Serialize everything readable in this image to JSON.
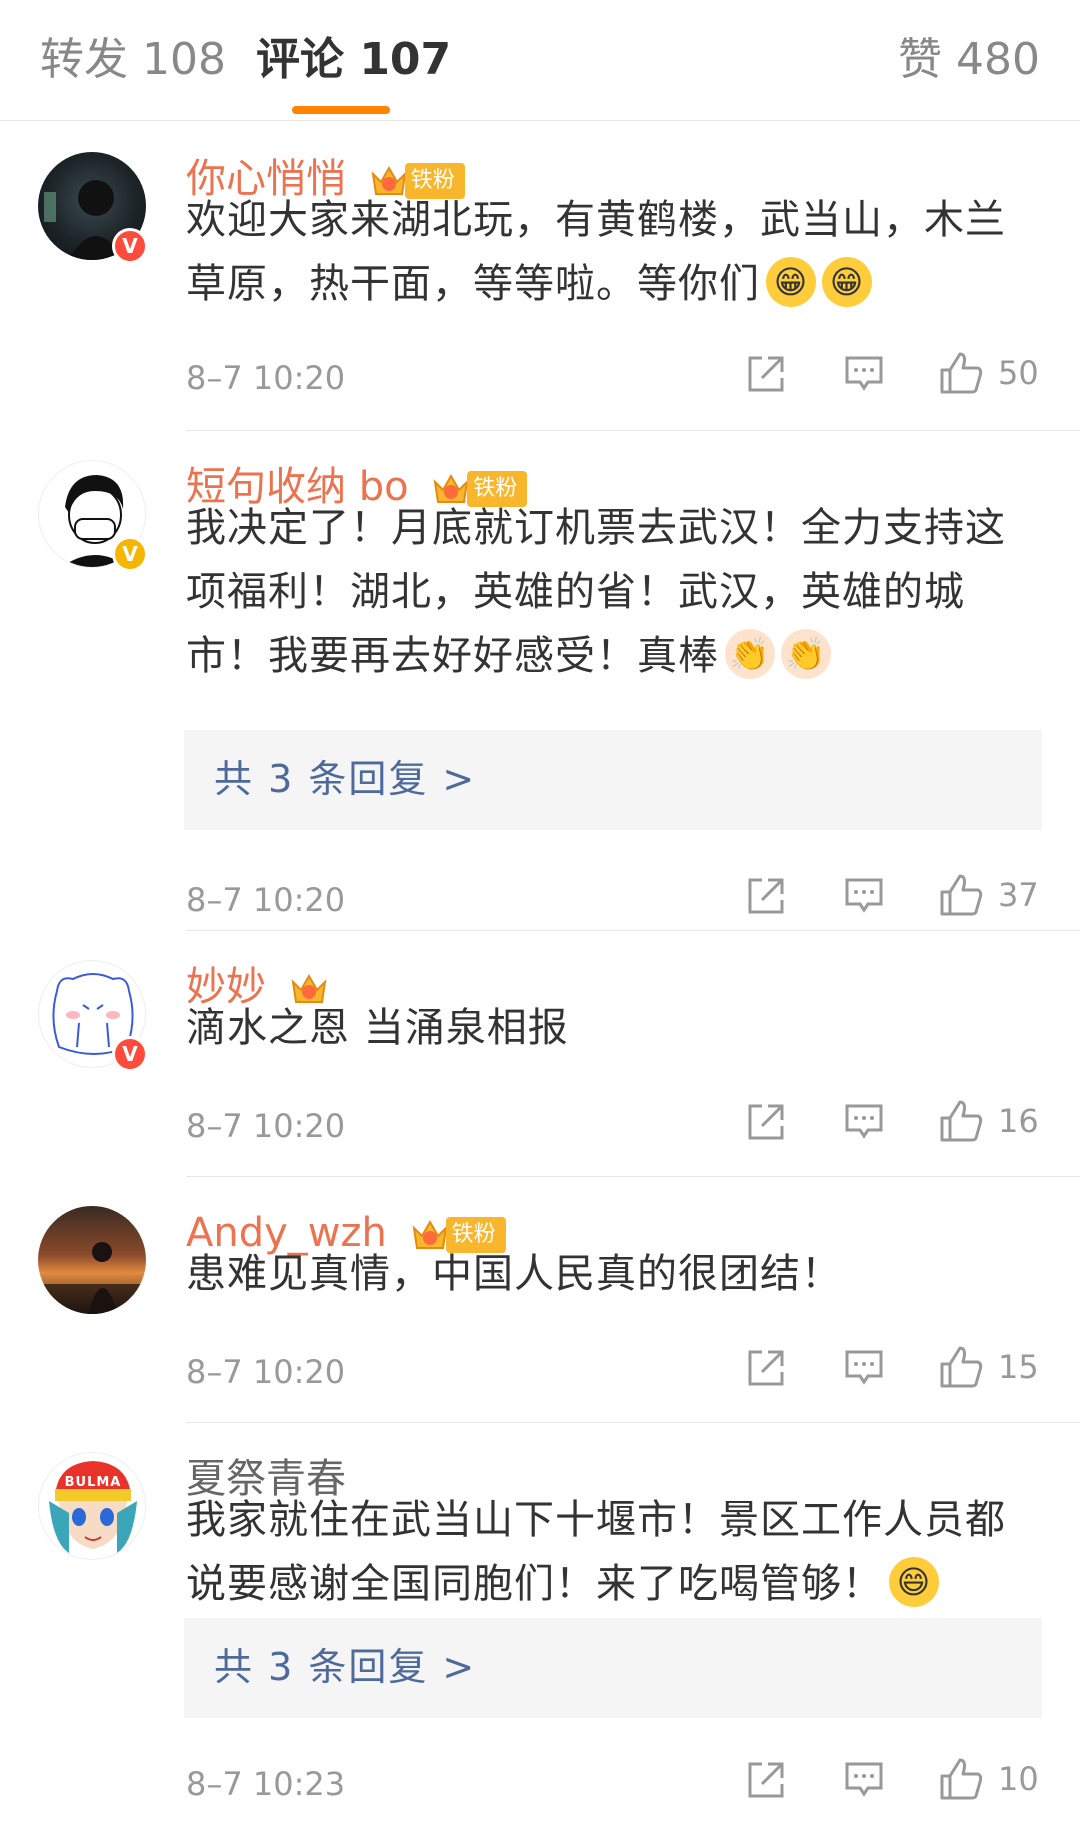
{
  "tabs": {
    "repost": "转发 108",
    "comments": "评论 107",
    "likes": "赞 480"
  },
  "colors": {
    "accent": "#ff8200",
    "username": "#eb7350",
    "link": "#4e6a9a"
  },
  "comments": [
    {
      "username": "你心悄悄",
      "fan_level": "2",
      "fan_label": "铁粉",
      "verified": "red",
      "text": "欢迎大家来湖北玩，有黄鹤楼，武当山，木兰草原，热干面，等等啦。等你们",
      "emojis": [
        "grin-emoji",
        "grin-emoji"
      ],
      "time": "8–7 10:20",
      "likes": "50"
    },
    {
      "username": "短句收纳 bo",
      "fan_level": "3",
      "fan_label": "铁粉",
      "verified": "gold",
      "text": "我决定了！月底就订机票去武汉！全力支持这项福利！湖北，英雄的省！武汉，英雄的城市！我要再去好好感受！真棒",
      "emojis": [
        "clap-emoji",
        "clap-emoji"
      ],
      "replies": "共 3 条回复 >",
      "time": "8–7 10:20",
      "likes": "37"
    },
    {
      "username": "妙妙",
      "fan_level": "4",
      "verified": "red",
      "text": "滴水之恩 当涌泉相报",
      "time": "8–7 10:20",
      "likes": "16"
    },
    {
      "username": "Andy_wzh",
      "fan_level": "6",
      "fan_label": "铁粉",
      "text": "患难见真情，中国人民真的很团结！",
      "time": "8–7 10:20",
      "likes": "15"
    },
    {
      "username": "夏祭青春",
      "text": "我家就住在武当山下十堰市！景区工作人员都说要感谢全国同胞们！来了吃喝管够！",
      "emojis": [
        "laugh-emoji"
      ],
      "replies": "共 3 条回复 >",
      "time": "8–7 10:23",
      "likes": "10",
      "avatar_text": "BULMA"
    }
  ]
}
